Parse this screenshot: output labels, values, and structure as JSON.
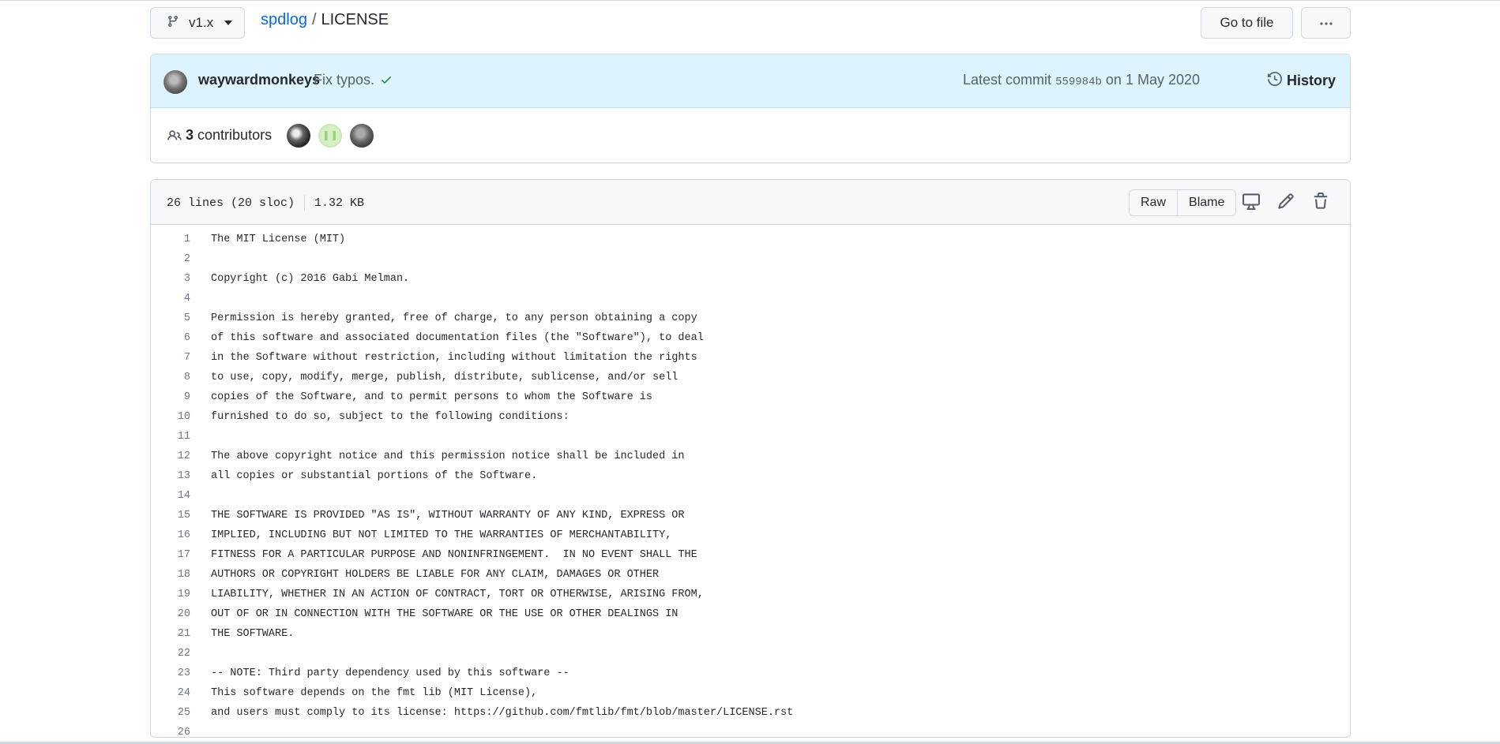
{
  "branch": {
    "name": "v1.x"
  },
  "breadcrumb": {
    "repo": "spdlog",
    "separator": "/",
    "file": "LICENSE"
  },
  "actions": {
    "goto_file": "Go to file",
    "more": "···"
  },
  "commit": {
    "author": "waywardmonkeys",
    "message": "Fix typos.",
    "latest_label": "Latest commit",
    "sha": "559984b",
    "date_prefix": "on",
    "date": "1 May 2020",
    "history": "History"
  },
  "contributors": {
    "count": "3",
    "label": "contributors"
  },
  "file": {
    "lines_info": "26 lines (20 sloc)",
    "size": "1.32 KB",
    "raw": "Raw",
    "blame": "Blame"
  },
  "code_lines": [
    "The MIT License (MIT)",
    "",
    "Copyright (c) 2016 Gabi Melman.",
    "",
    "Permission is hereby granted, free of charge, to any person obtaining a copy",
    "of this software and associated documentation files (the \"Software\"), to deal",
    "in the Software without restriction, including without limitation the rights",
    "to use, copy, modify, merge, publish, distribute, sublicense, and/or sell",
    "copies of the Software, and to permit persons to whom the Software is",
    "furnished to do so, subject to the following conditions:",
    "",
    "The above copyright notice and this permission notice shall be included in",
    "all copies or substantial portions of the Software.",
    "",
    "THE SOFTWARE IS PROVIDED \"AS IS\", WITHOUT WARRANTY OF ANY KIND, EXPRESS OR",
    "IMPLIED, INCLUDING BUT NOT LIMITED TO THE WARRANTIES OF MERCHANTABILITY,",
    "FITNESS FOR A PARTICULAR PURPOSE AND NONINFRINGEMENT.  IN NO EVENT SHALL THE",
    "AUTHORS OR COPYRIGHT HOLDERS BE LIABLE FOR ANY CLAIM, DAMAGES OR OTHER",
    "LIABILITY, WHETHER IN AN ACTION OF CONTRACT, TORT OR OTHERWISE, ARISING FROM,",
    "OUT OF OR IN CONNECTION WITH THE SOFTWARE OR THE USE OR OTHER DEALINGS IN",
    "THE SOFTWARE.",
    "",
    "-- NOTE: Third party dependency used by this software --",
    "This software depends on the fmt lib (MIT License),",
    "and users must comply to its license: https://github.com/fmtlib/fmt/blob/master/LICENSE.rst",
    ""
  ],
  "colors": {
    "link": "#0969da",
    "commit_bg": "#ddf4ff",
    "success": "#1a7f37",
    "border": "#d0d7de"
  },
  "icons": [
    "git-branch-icon",
    "caret-down-icon",
    "kebab-horizontal-icon",
    "check-icon",
    "history-icon",
    "people-icon",
    "desktop-icon",
    "pencil-icon",
    "trash-icon"
  ]
}
